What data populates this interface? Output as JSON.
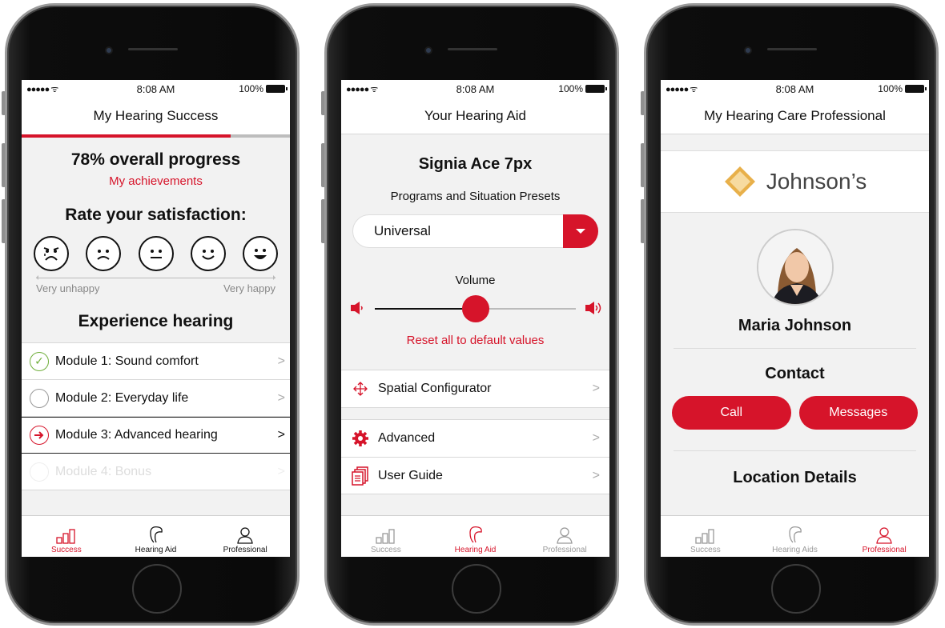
{
  "status": {
    "signal": "●●●●● ᯤ",
    "time": "8:08 AM",
    "battery": "100%"
  },
  "screen1": {
    "title": "My Hearing Success",
    "progress_fraction": 0.78,
    "headline": "78% overall progress",
    "achievements_link": "My achievements",
    "rate_title": "Rate your satisfaction:",
    "scale_low": "Very unhappy",
    "scale_high": "Very happy",
    "experience_title": "Experience hearing",
    "modules": [
      {
        "label": "Module 1: Sound comfort",
        "state": "done"
      },
      {
        "label": "Module 2: Everyday life",
        "state": "todo"
      },
      {
        "label": "Module 3: Advanced hearing",
        "state": "active"
      },
      {
        "label": "Module 4: Bonus",
        "state": "locked"
      }
    ],
    "tabs": [
      "Success",
      "Hearing Aid",
      "Professional"
    ]
  },
  "screen2": {
    "title": "Your Hearing Aid",
    "device": "Signia Ace 7px",
    "programs_label": "Programs and Situation Presets",
    "program_value": "Universal",
    "volume_label": "Volume",
    "volume_fraction": 0.5,
    "reset_link": "Reset all to default values",
    "menu": [
      "Spatial Configurator",
      "Advanced",
      "User Guide"
    ],
    "tabs": [
      "Success",
      "Hearing Aid",
      "Professional"
    ]
  },
  "screen3": {
    "title": "My Hearing Care Professional",
    "brand": "Johnson’s",
    "name": "Maria Johnson",
    "contact_title": "Contact",
    "call_label": "Call",
    "messages_label": "Messages",
    "location_title": "Location Details",
    "tabs": [
      "Success",
      "Hearing Aids",
      "Professional"
    ]
  },
  "colors": {
    "accent": "#d6142a",
    "gold": "#e8b04a"
  }
}
